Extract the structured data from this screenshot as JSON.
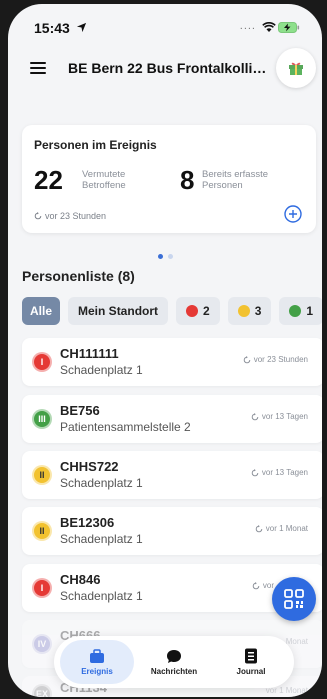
{
  "status_bar": {
    "time": "15:43",
    "dots": "....",
    "icons": [
      "location-arrow-icon",
      "wifi-icon",
      "battery-charging-icon"
    ]
  },
  "header": {
    "title": "BE Bern 22 Bus Frontalkollisi...",
    "menu_icon": "hamburger-icon",
    "right_icon": "gift-icon"
  },
  "summary_card": {
    "title": "Personen im Ereignis",
    "suspected_count": "22",
    "suspected_label_line1": "Vermutete",
    "suspected_label_line2": "Betroffene",
    "recorded_count": "8",
    "recorded_label_line1": "Bereits erfasste",
    "recorded_label_line2": "Personen",
    "updated": "vor 23 Stunden"
  },
  "person_list": {
    "heading": "Personenliste (8)",
    "filters": {
      "all": "Alle",
      "location": "Mein Standort",
      "red_count": "2",
      "yellow_count": "3",
      "green_count": "1"
    },
    "rows": [
      {
        "category": "I",
        "id": "CH111111",
        "location": "Schadenplatz 1",
        "time": "vor 23 Stunden"
      },
      {
        "category": "III",
        "id": "BE756",
        "location": "Patientensammelstelle 2",
        "time": "vor 13 Tagen"
      },
      {
        "category": "II",
        "id": "CHHS722",
        "location": "Schadenplatz 1",
        "time": "vor 13 Tagen"
      },
      {
        "category": "II",
        "id": "BE12306",
        "location": "Schadenplatz 1",
        "time": "vor 1 Monat"
      },
      {
        "category": "I",
        "id": "CH846",
        "location": "Schadenplatz 1",
        "time": "vor"
      },
      {
        "category": "IV",
        "id": "CH666",
        "location": "",
        "time": "Monat"
      },
      {
        "category": "EX",
        "id": "CH1134",
        "location": "",
        "time": "vor 1 Monat"
      }
    ]
  },
  "colors": {
    "red": "#e53935",
    "green": "#43a047",
    "yellow": "#f2c230",
    "blue": "#2f6be0",
    "purple": "#7e7ec8",
    "grey": "#8d8d8d"
  },
  "tabbar": {
    "tab1": "Ereignis",
    "tab2": "Nachrichten",
    "tab3": "Journal"
  }
}
